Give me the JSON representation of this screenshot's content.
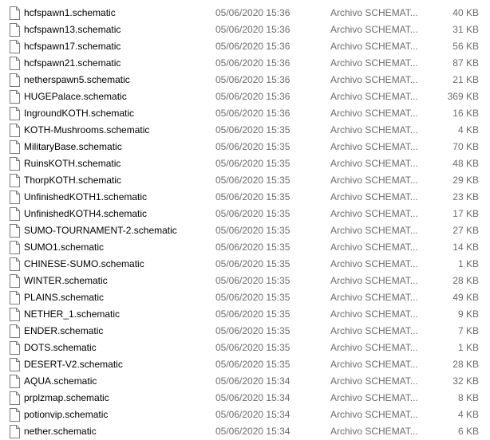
{
  "files": [
    {
      "name": "hcfspawn1.schematic",
      "date": "05/06/2020 15:36",
      "type": "Archivo SCHEMAT...",
      "size": "40 KB"
    },
    {
      "name": "hcfspawn13.schematic",
      "date": "05/06/2020 15:36",
      "type": "Archivo SCHEMAT...",
      "size": "31 KB"
    },
    {
      "name": "hcfspawn17.schematic",
      "date": "05/06/2020 15:36",
      "type": "Archivo SCHEMAT...",
      "size": "56 KB"
    },
    {
      "name": "hcfspawn21.schematic",
      "date": "05/06/2020 15:36",
      "type": "Archivo SCHEMAT...",
      "size": "87 KB"
    },
    {
      "name": "netherspawn5.schematic",
      "date": "05/06/2020 15:36",
      "type": "Archivo SCHEMAT...",
      "size": "21 KB"
    },
    {
      "name": "HUGEPalace.schematic",
      "date": "05/06/2020 15:36",
      "type": "Archivo SCHEMAT...",
      "size": "369 KB"
    },
    {
      "name": "IngroundKOTH.schematic",
      "date": "05/06/2020 15:36",
      "type": "Archivo SCHEMAT...",
      "size": "16 KB"
    },
    {
      "name": "KOTH-Mushrooms.schematic",
      "date": "05/06/2020 15:35",
      "type": "Archivo SCHEMAT...",
      "size": "4 KB"
    },
    {
      "name": "MilitaryBase.schematic",
      "date": "05/06/2020 15:35",
      "type": "Archivo SCHEMAT...",
      "size": "70 KB"
    },
    {
      "name": "RuinsKOTH.schematic",
      "date": "05/06/2020 15:35",
      "type": "Archivo SCHEMAT...",
      "size": "48 KB"
    },
    {
      "name": "ThorpKOTH.schematic",
      "date": "05/06/2020 15:35",
      "type": "Archivo SCHEMAT...",
      "size": "29 KB"
    },
    {
      "name": "UnfinishedKOTH1.schematic",
      "date": "05/06/2020 15:35",
      "type": "Archivo SCHEMAT...",
      "size": "23 KB"
    },
    {
      "name": "UnfinishedKOTH4.schematic",
      "date": "05/06/2020 15:35",
      "type": "Archivo SCHEMAT...",
      "size": "17 KB"
    },
    {
      "name": "SUMO-TOURNAMENT-2.schematic",
      "date": "05/06/2020 15:35",
      "type": "Archivo SCHEMAT...",
      "size": "27 KB"
    },
    {
      "name": "SUMO1.schematic",
      "date": "05/06/2020 15:35",
      "type": "Archivo SCHEMAT...",
      "size": "14 KB"
    },
    {
      "name": "CHINESE-SUMO.schematic",
      "date": "05/06/2020 15:35",
      "type": "Archivo SCHEMAT...",
      "size": "1 KB"
    },
    {
      "name": "WINTER.schematic",
      "date": "05/06/2020 15:35",
      "type": "Archivo SCHEMAT...",
      "size": "28 KB"
    },
    {
      "name": "PLAINS.schematic",
      "date": "05/06/2020 15:35",
      "type": "Archivo SCHEMAT...",
      "size": "49 KB"
    },
    {
      "name": "NETHER_1.schematic",
      "date": "05/06/2020 15:35",
      "type": "Archivo SCHEMAT...",
      "size": "9 KB"
    },
    {
      "name": "ENDER.schematic",
      "date": "05/06/2020 15:35",
      "type": "Archivo SCHEMAT...",
      "size": "7 KB"
    },
    {
      "name": "DOTS.schematic",
      "date": "05/06/2020 15:35",
      "type": "Archivo SCHEMAT...",
      "size": "1 KB"
    },
    {
      "name": "DESERT-V2.schematic",
      "date": "05/06/2020 15:35",
      "type": "Archivo SCHEMAT...",
      "size": "28 KB"
    },
    {
      "name": "AQUA.schematic",
      "date": "05/06/2020 15:34",
      "type": "Archivo SCHEMAT...",
      "size": "32 KB"
    },
    {
      "name": "prplzmap.schematic",
      "date": "05/06/2020 15:34",
      "type": "Archivo SCHEMAT...",
      "size": "8 KB"
    },
    {
      "name": "potionvip.schematic",
      "date": "05/06/2020 15:34",
      "type": "Archivo SCHEMAT...",
      "size": "4 KB"
    },
    {
      "name": "nether.schematic",
      "date": "05/06/2020 15:34",
      "type": "Archivo SCHEMAT...",
      "size": "6 KB"
    }
  ],
  "icon": "file-icon",
  "colors": {
    "name_text": "#000000",
    "meta_text": "#6d6d6d",
    "icon_stroke": "#7a7a7a"
  }
}
